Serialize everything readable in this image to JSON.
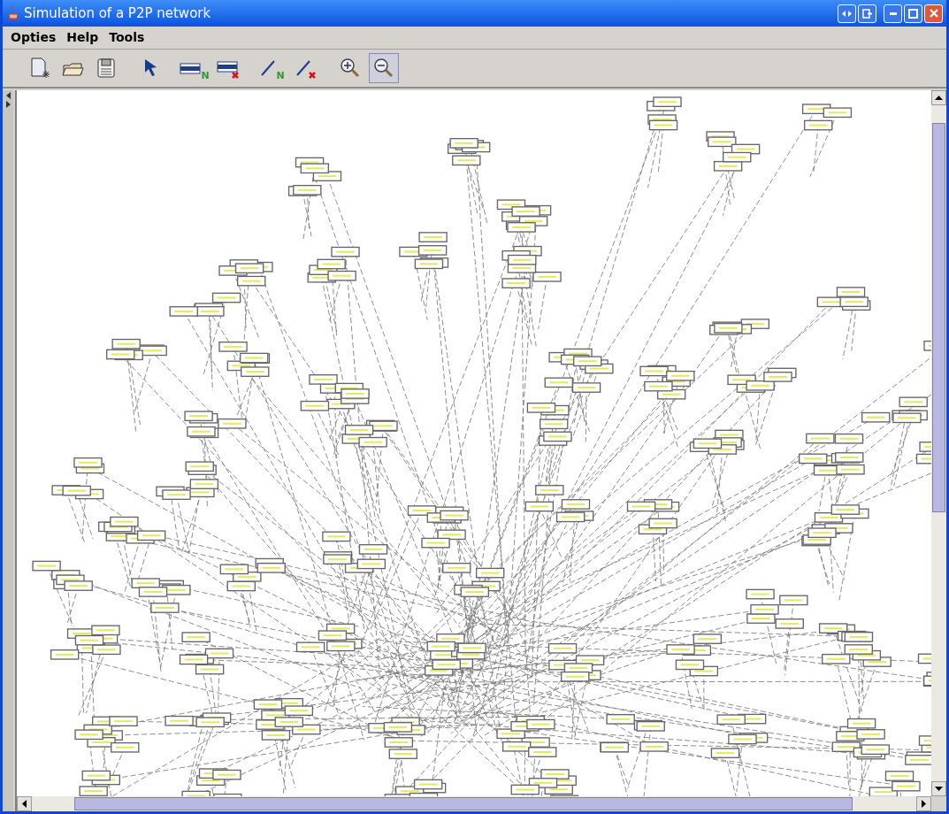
{
  "window": {
    "title": "Simulation of a P2P network"
  },
  "menu": [
    "Opties",
    "Help",
    "Tools"
  ],
  "toolbar": [
    {
      "selected": false
    },
    {
      "selected": false
    },
    {
      "selected": false
    },
    {
      "selected": false
    },
    {
      "selected": false,
      "badge": "N"
    },
    {
      "selected": false
    },
    {
      "selected": false,
      "badge": "N"
    },
    {
      "selected": false
    },
    {
      "selected": false
    },
    {
      "selected": true
    }
  ]
}
